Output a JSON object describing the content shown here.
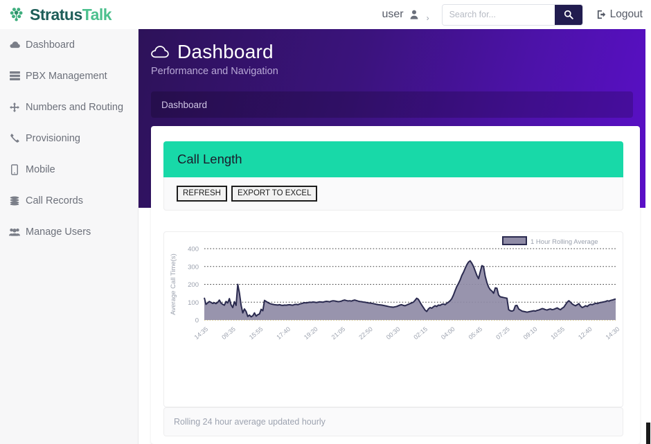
{
  "brand": {
    "name_first": "Stratus",
    "name_second": "Talk",
    "logo_icon": "molecule-cluster-icon"
  },
  "topbar": {
    "user_label": "user",
    "user_icon": "user-icon",
    "user_caret_icon": "chevron-right-icon",
    "logout_label": "Logout",
    "logout_icon": "sign-out-icon"
  },
  "search": {
    "placeholder": "Search for...",
    "value": "",
    "button_icon": "search-icon",
    "button_color": "#211c4f"
  },
  "sidebar": {
    "items": [
      {
        "label": "Dashboard",
        "icon": "cloud-icon"
      },
      {
        "label": "PBX Management",
        "icon": "server-icon"
      },
      {
        "label": "Numbers and Routing",
        "icon": "arrows-move-icon"
      },
      {
        "label": "Provisioning",
        "icon": "phone-icon"
      },
      {
        "label": "Mobile",
        "icon": "mobile-icon"
      },
      {
        "label": "Call Records",
        "icon": "database-icon"
      },
      {
        "label": "Manage Users",
        "icon": "users-icon"
      }
    ]
  },
  "hero": {
    "title": "Dashboard",
    "title_icon": "cloud-icon",
    "subtitle": "Performance and Navigation",
    "breadcrumb": "Dashboard",
    "gradient_start": "#2d1259",
    "gradient_end": "#5a0fc8"
  },
  "panel": {
    "title": "Call Length",
    "header_color": "#18d9a8",
    "refresh_label": "REFRESH",
    "export_label": "EXPORT TO EXCEL",
    "footer_note": "Rolling 24 hour average updated hourly"
  },
  "chart_data": {
    "type": "area",
    "title": "",
    "xlabel": "",
    "ylabel": "Average Call Time(s)",
    "ylim": [
      0,
      400
    ],
    "yticks": [
      0,
      100,
      200,
      300,
      400
    ],
    "grid": true,
    "legend_position": "top-right",
    "legend": [
      "1 Hour Rolling Average"
    ],
    "line_color": "#2a2a4f",
    "fill_color": "#8f8ba6",
    "baseline_color": "#d9c97a",
    "xticks": [
      "14:35",
      "09:35",
      "15:55",
      "17:40",
      "19:20",
      "21:05",
      "22:50",
      "00:30",
      "02:15",
      "04:00",
      "05:45",
      "07:25",
      "09:10",
      "10:55",
      "12:40",
      "14:30"
    ],
    "series": [
      {
        "name": "1 Hour Rolling Average",
        "values": [
          125,
          88,
          96,
          104,
          99,
          93,
          97,
          92,
          99,
          112,
          95,
          88,
          83,
          104,
          96,
          120,
          86,
          70,
          103,
          82,
          200,
          152,
          84,
          40,
          62,
          48,
          20,
          28,
          18,
          24,
          40,
          22,
          30,
          34,
          60,
          52,
          110,
          104,
          98,
          93,
          90,
          88,
          86,
          85,
          84,
          86,
          83,
          82,
          84,
          83,
          85,
          86,
          84,
          83,
          87,
          88,
          86,
          90,
          92,
          95,
          97,
          96,
          98,
          100,
          99,
          101,
          100,
          98,
          100,
          102,
          101,
          100,
          103,
          105,
          104,
          102,
          106,
          108,
          107,
          105,
          103,
          104,
          106,
          110,
          112,
          109,
          107,
          108,
          106,
          110,
          112,
          109,
          106,
          104,
          103,
          101,
          100,
          98,
          96,
          95,
          94,
          92,
          90,
          88,
          86,
          85,
          84,
          82,
          80,
          78,
          76,
          74,
          73,
          72,
          74,
          76,
          80,
          84,
          86,
          82,
          80,
          84,
          88,
          92,
          96,
          100,
          110,
          122,
          116,
          100,
          84,
          70,
          56,
          48,
          62,
          70,
          66,
          74,
          80,
          76,
          84,
          82,
          88,
          90,
          86,
          94,
          100,
          108,
          120,
          140,
          165,
          188,
          205,
          225,
          250,
          268,
          290,
          310,
          325,
          332,
          318,
          300,
          275,
          250,
          232,
          270,
          305,
          300,
          245,
          210,
          185,
          170,
          162,
          150,
          180,
          178,
          140,
          130,
          128,
          126,
          124,
          122,
          58,
          52,
          50,
          54,
          80,
          82,
          62,
          56,
          50,
          48,
          46,
          44,
          46,
          48,
          50,
          52,
          50,
          54,
          56,
          60,
          64,
          62,
          58,
          56,
          60,
          62,
          58,
          60,
          64,
          68,
          62,
          58,
          66,
          72,
          86,
          100,
          108,
          100,
          90,
          84,
          80,
          86,
          92,
          78,
          70,
          74,
          80,
          76,
          84,
          88,
          86,
          90,
          94,
          92,
          96,
          98,
          100,
          102,
          104,
          108,
          106,
          110,
          112,
          115,
          118
        ]
      }
    ]
  }
}
